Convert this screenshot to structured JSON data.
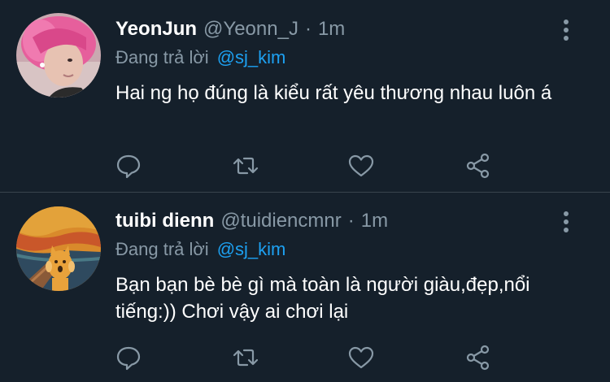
{
  "tweets": [
    {
      "display_name": "YeonJun",
      "handle": "@Yeonn_J",
      "separator": "·",
      "time": "1m",
      "reply_prefix": "Đang trả lời",
      "reply_to": "@sj_kim",
      "text": "Hai ng họ đúng là kiểu rất yêu thương nhau luôn á",
      "avatar": "avatar-pink-hair-person"
    },
    {
      "display_name": "tuibi dienn",
      "handle": "@tuidiencmnr",
      "separator": "·",
      "time": "1m",
      "reply_prefix": "Đang trả lời",
      "reply_to": "@sj_kim",
      "text": "Bạn bạn bè bè gì mà toàn là người giàu,đẹp,nổi tiếng:)) Chơi vậy ai chơi lại",
      "avatar": "avatar-scream-painting-cat"
    }
  ],
  "actions": [
    "reply-icon",
    "retweet-icon",
    "like-icon",
    "share-icon"
  ],
  "colors": {
    "background": "#15202b",
    "text": "#ffffff",
    "secondary": "#8899a6",
    "accent": "#1da1f2",
    "divider": "#38444d"
  }
}
